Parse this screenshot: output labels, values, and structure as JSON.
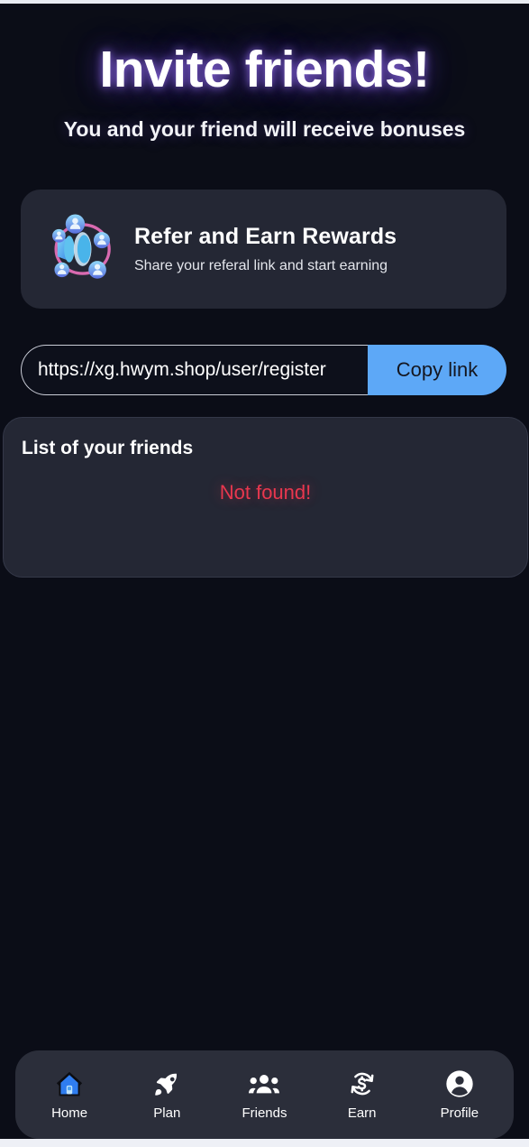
{
  "header": {
    "title": "Invite friends!",
    "subtitle": "You and your friend will receive bonuses"
  },
  "refer_card": {
    "icon": "referral-network-illustration",
    "title": "Refer and Earn Rewards",
    "subtitle": "Share your referal link and start earning"
  },
  "link_row": {
    "value": "https://xg.hwym.shop/user/register",
    "placeholder": "https://xg.hwym.shop/user/register",
    "copy_label": "Copy link",
    "button_color": "#5da8f7"
  },
  "friends": {
    "title": "List of your friends",
    "empty_text": "Not found!",
    "empty_color": "#e8374e"
  },
  "bottom_nav": {
    "items": [
      {
        "label": "Home",
        "icon": "home-icon",
        "active": true
      },
      {
        "label": "Plan",
        "icon": "rocket-icon",
        "active": false
      },
      {
        "label": "Friends",
        "icon": "people-icon",
        "active": false
      },
      {
        "label": "Earn",
        "icon": "dollar-refresh-icon",
        "active": false
      },
      {
        "label": "Profile",
        "icon": "person-circle-icon",
        "active": false
      }
    ]
  },
  "colors": {
    "page_background": "#0b0d17",
    "card_background": "#242734",
    "nav_background": "#2b2e3a",
    "accent_blue": "#5da8f7",
    "glow_purple": "#a078ff"
  }
}
